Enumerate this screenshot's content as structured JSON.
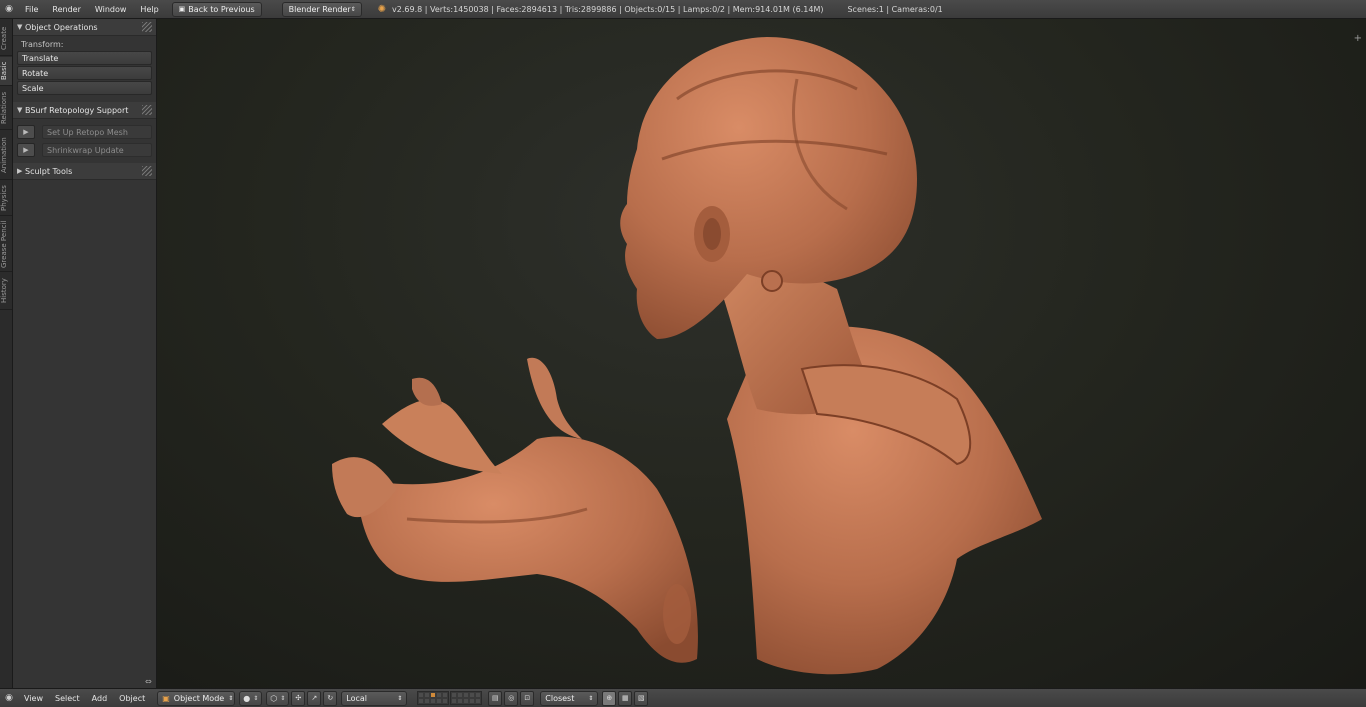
{
  "topbar": {
    "menus": [
      "File",
      "Render",
      "Window",
      "Help"
    ],
    "back_button": "Back to Previous",
    "render_engine": "Blender Render",
    "stats": "v2.69.8 | Verts:1450038 | Faces:2894613 | Tris:2899886 | Objects:0/15 | Lamps:0/2 | Mem:914.01M (6.14M)",
    "scenes": "Scenes:1 | Cameras:0/1"
  },
  "tabs": [
    "Create",
    "Basic",
    "Relations",
    "Animation",
    "Physics",
    "Grease Pencil",
    "History"
  ],
  "toolshelf": {
    "object_ops": {
      "title": "Object Operations",
      "subhead": "Transform:",
      "buttons": [
        "Translate",
        "Rotate",
        "Scale"
      ]
    },
    "bsurf": {
      "title": "BSurf Retopology Support",
      "buttons": [
        "Set Up Retopo Mesh",
        "Shrinkwrap Update"
      ]
    },
    "sculpt": {
      "title": "Sculpt Tools"
    }
  },
  "bottombar": {
    "menus": [
      "View",
      "Select",
      "Add",
      "Object"
    ],
    "mode": "Object Mode",
    "orientation": "Local",
    "snap_target": "Closest"
  },
  "colors": {
    "model": "#c27a57",
    "accent": "#e8a24a"
  }
}
